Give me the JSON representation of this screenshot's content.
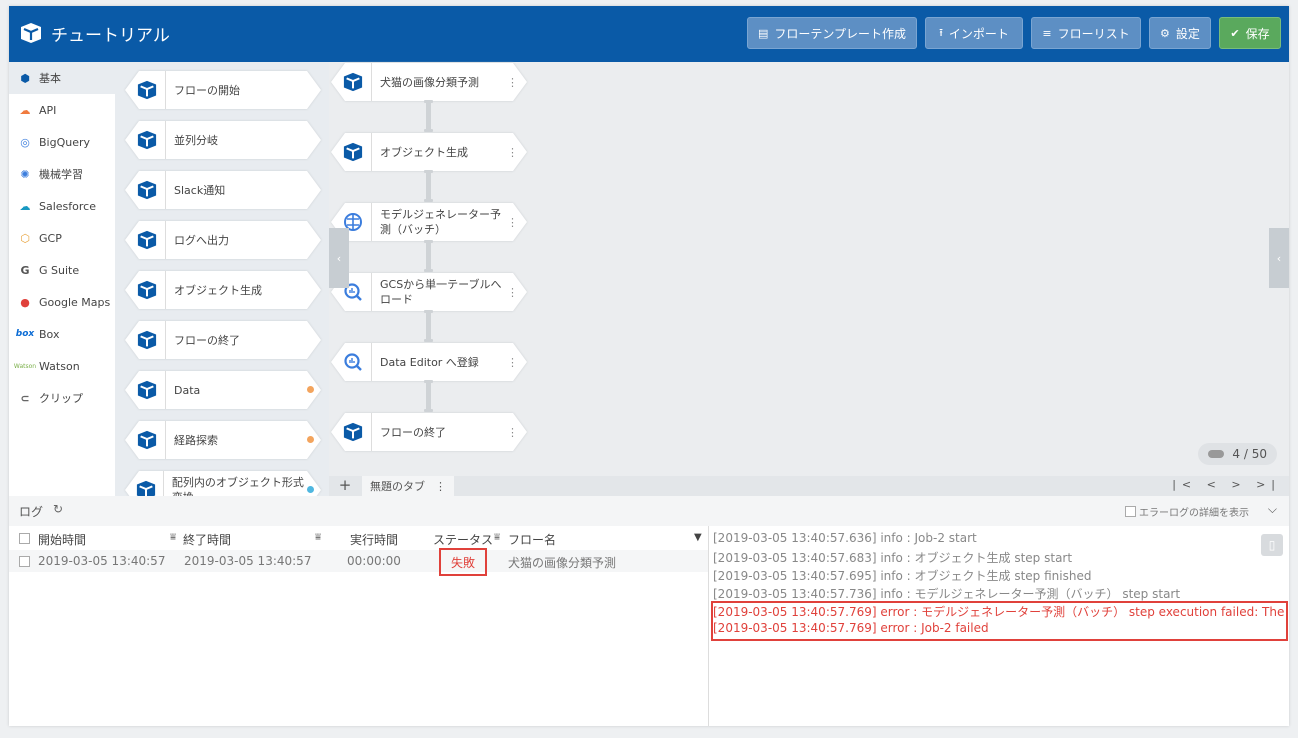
{
  "header": {
    "title": "チュートリアル",
    "buttons": [
      {
        "label": "フローテンプレート作成",
        "icon": "document-icon"
      },
      {
        "label": "インポート",
        "icon": "upload-icon"
      },
      {
        "label": "フローリスト",
        "icon": "list-icon"
      },
      {
        "label": "設定",
        "icon": "gear-icon"
      },
      {
        "label": "保存",
        "icon": "check-circle-icon"
      }
    ]
  },
  "categories": [
    {
      "label": "基本",
      "icon": "cube-icon",
      "active": true
    },
    {
      "label": "API",
      "icon": "cloud-api-icon"
    },
    {
      "label": "BigQuery",
      "icon": "bigquery-icon"
    },
    {
      "label": "機械学習",
      "icon": "brain-icon"
    },
    {
      "label": "Salesforce",
      "icon": "salesforce-cloud-icon"
    },
    {
      "label": "GCP",
      "icon": "gcp-icon"
    },
    {
      "label": "G Suite",
      "icon": "g-suite-icon"
    },
    {
      "label": "Google Maps",
      "icon": "map-pin-icon"
    },
    {
      "label": "Box",
      "icon": "box-logo-icon"
    },
    {
      "label": "Watson",
      "icon": "watson-logo-icon"
    },
    {
      "label": "クリップ",
      "icon": "paperclip-icon"
    }
  ],
  "palette": [
    {
      "label": "フローの開始"
    },
    {
      "label": "並列分岐"
    },
    {
      "label": "Slack通知"
    },
    {
      "label": "ログへ出力"
    },
    {
      "label": "オブジェクト生成"
    },
    {
      "label": "フローの終了"
    },
    {
      "label": "Data",
      "badge": "orange"
    },
    {
      "label": "経路探索",
      "badge": "orange"
    },
    {
      "label": "配列内のオブジェクト形式変換",
      "badge": "blue"
    }
  ],
  "flow": [
    {
      "label": "犬猫の画像分類予測",
      "icon": "cube-icon"
    },
    {
      "label": "オブジェクト生成",
      "icon": "cube-icon"
    },
    {
      "label": "モデルジェネレーター予測（バッチ）",
      "icon": "brain-icon"
    },
    {
      "label": "GCSから単一テーブルへロード",
      "icon": "bigquery-icon"
    },
    {
      "label": "Data Editor へ登録",
      "icon": "bigquery-icon"
    },
    {
      "label": "フローの終了",
      "icon": "cube-icon"
    }
  ],
  "counter": "4 / 50",
  "tabs": {
    "add": "+",
    "current": "無題のタブ",
    "nav": "|< < > >|"
  },
  "log": {
    "title": "ログ",
    "error_detail_label": "エラーログの詳細を表示",
    "columns": {
      "start": "開始時間",
      "end": "終了時間",
      "duration": "実行時間",
      "status": "ステータス",
      "flow": "フロー名"
    },
    "rows": [
      {
        "start": "2019-03-05 13:40:57",
        "end": "2019-03-05 13:40:57",
        "duration": "00:00:00",
        "status": "失敗",
        "flow": "犬猫の画像分類予測"
      }
    ],
    "lines": [
      {
        "text": "[2019-03-05 13:40:57.636]  info : Job-2 start",
        "level": "info"
      },
      {
        "text": "[2019-03-05 13:40:57.683]  info : オブジェクト生成 step start",
        "level": "info"
      },
      {
        "text": "[2019-03-05 13:40:57.695]  info : オブジェクト生成 step finished",
        "level": "info"
      },
      {
        "text": "[2019-03-05 13:40:57.736]  info : モデルジェネレーター予測（バッチ） step start",
        "level": "info"
      },
      {
        "text": "[2019-03-05 13:40:57.769] error : モデルジェネレーター予測（バッチ） step execution failed: The",
        "level": "error"
      },
      {
        "text": "[2019-03-05 13:40:57.769] error : Job-2 failed",
        "level": "error"
      }
    ]
  }
}
